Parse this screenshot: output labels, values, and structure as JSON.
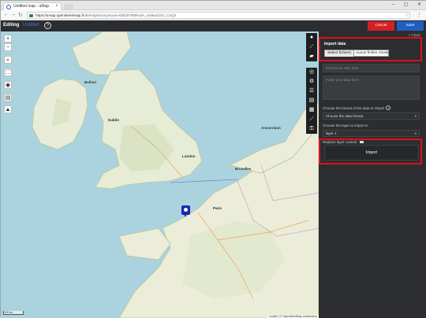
{
  "browser": {
    "tab_title": "Untitled map - uMap",
    "tab_close": "×",
    "window_controls": "–  ▢  ✕",
    "back_icon": "arrow-left-icon",
    "forward_icon": "arrow-right-icon",
    "reload_icon": "reload-icon",
    "url_host": "https://umap.openstreetmap.fr",
    "url_path": "/de/map/anonymous-edit/167959%3A_LKBwG2rd_CUQo",
    "star": "☆",
    "menu": "⋮"
  },
  "header": {
    "editing_label": "Editing",
    "map_name": "Untitled",
    "help": "?",
    "cancel_label": "Cancel",
    "save_label": "Save"
  },
  "map": {
    "left_controls": [
      "+",
      "−",
      "⌕",
      "⛶",
      "◉",
      "▤",
      "▲"
    ],
    "right_tools": [
      "●",
      "⟋",
      "▰",
      "◎",
      "⚙",
      "☰",
      "▤",
      "▦",
      "⟋",
      "⚿"
    ],
    "cities": [
      {
        "name": "Dublin"
      },
      {
        "name": "London"
      },
      {
        "name": "Paris"
      },
      {
        "name": "Bruxelles"
      },
      {
        "name": "Amsterdam"
      },
      {
        "name": "Belfast"
      }
    ],
    "attribution": "Leaflet | © OpenStreetMap contributors",
    "scale_label": "100 km"
  },
  "panel": {
    "close_label": "× Close",
    "title": "Import data",
    "file_button": "Select  fichiers",
    "file_status": "Aucun fichier choisi",
    "url_placeholder": "Provide an URL here",
    "paste_placeholder": "Paste your data here",
    "format_label": "Choose the format of the data to import",
    "format_help": "?",
    "format_value": "Choose the data format",
    "layer_label": "Choose the layer to import in",
    "layer_value": "layer 1",
    "replace_label": "Replace layer content",
    "import_label": "Import"
  },
  "colors": {
    "accent_red": "#e0101b",
    "cancel": "#d41f26",
    "save": "#1f5fc2",
    "panel_bg": "#2b2d31",
    "marker": "#1a2aa8"
  }
}
